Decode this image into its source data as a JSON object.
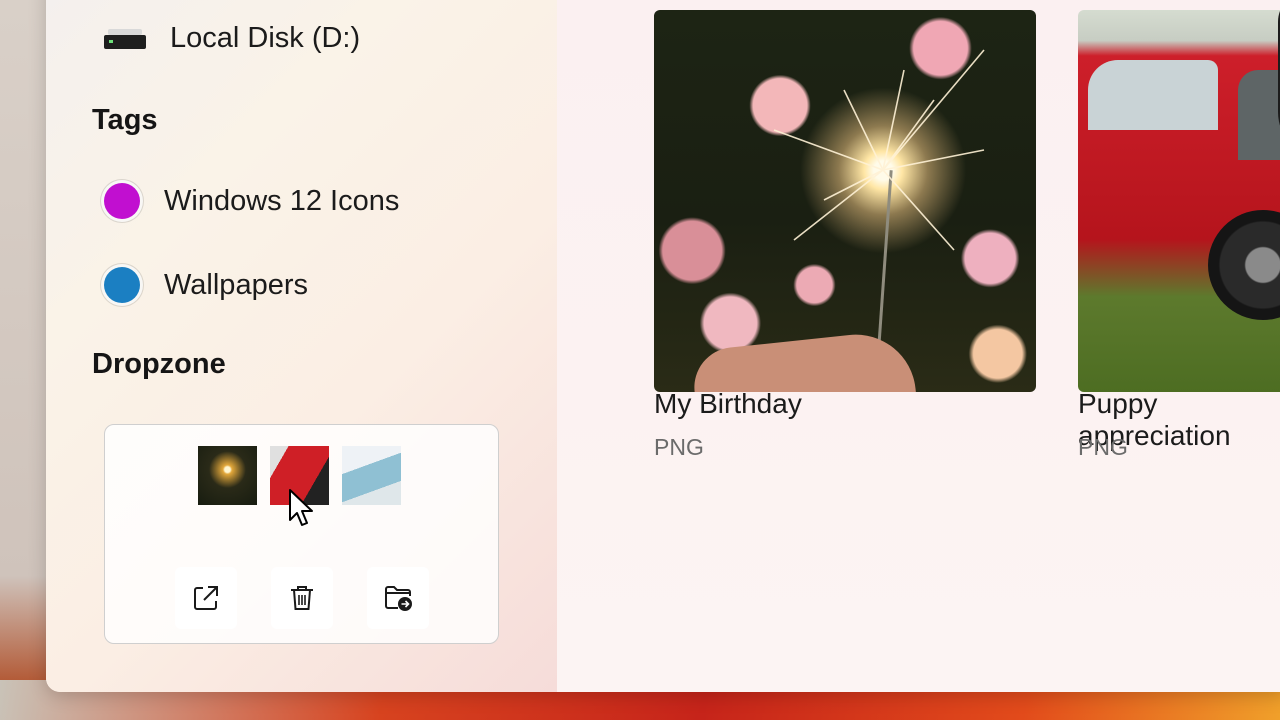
{
  "sidebar": {
    "drive": {
      "label": "Local Disk (D:)",
      "icon": "drive-icon"
    },
    "tags_heading": "Tags",
    "tags": [
      {
        "label": "Windows 12 Icons",
        "color": "#c10fd0"
      },
      {
        "label": "Wallpapers",
        "color": "#1b7fc2"
      }
    ],
    "dropzone_heading": "Dropzone",
    "dropzone": {
      "actions": [
        {
          "icon": "open-external-icon"
        },
        {
          "icon": "trash-icon"
        },
        {
          "icon": "move-to-folder-icon"
        }
      ]
    }
  },
  "files": [
    {
      "name": "My Birthday",
      "type": "PNG"
    },
    {
      "name": "Puppy appreciation",
      "type": "PNG"
    }
  ]
}
